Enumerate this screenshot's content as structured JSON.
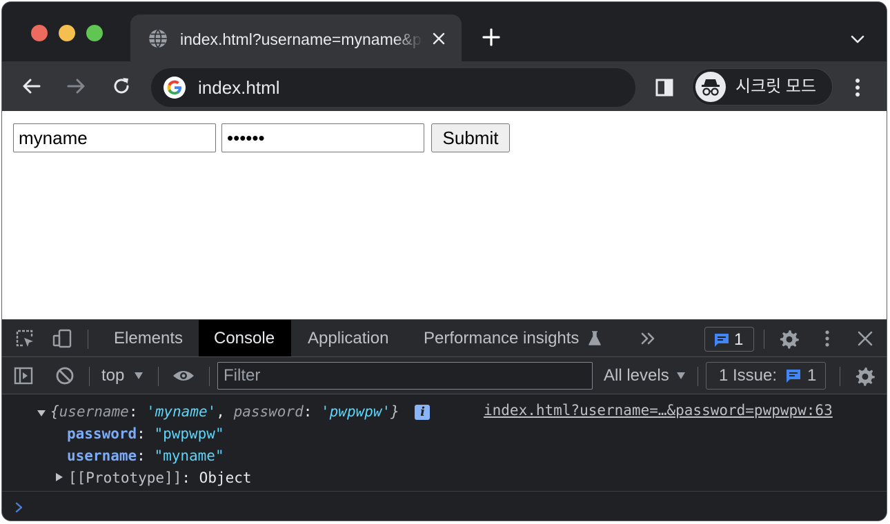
{
  "window": {
    "tab_title": "index.html?username=myname&password=pwpwpw",
    "url": "index.html",
    "profile_label": "시크릿 모드"
  },
  "page": {
    "username_value": "myname",
    "password_mask": "••••••",
    "submit_label": "Submit"
  },
  "devtools": {
    "tabs": [
      {
        "label": "Elements"
      },
      {
        "label": "Console"
      },
      {
        "label": "Application"
      },
      {
        "label": "Performance insights"
      }
    ],
    "active_tab": "Console",
    "message_count": "1",
    "context": "top",
    "filter_placeholder": "Filter",
    "levels_label": "All levels",
    "issue_label": "1 Issue:",
    "issue_count": "1"
  },
  "console": {
    "summary": {
      "open": "{",
      "k1": "username",
      "v1": "'myname'",
      "k2": "password",
      "v2": "'pwpwpw'",
      "close": "}"
    },
    "source": "index.html?username=…&password=pwpwpw:63",
    "props": [
      {
        "name": "password",
        "value": "\"pwpwpw\""
      },
      {
        "name": "username",
        "value": "\"myname\""
      }
    ],
    "prototype_key": "[[Prototype]]",
    "prototype_value": "Object"
  },
  "colors": {
    "chrome_dark": "#202124",
    "toolbar": "#35363a",
    "accent_blue": "#8ab4f8",
    "string_value": "#5cd5fb",
    "property_name": "#7cacf8"
  }
}
